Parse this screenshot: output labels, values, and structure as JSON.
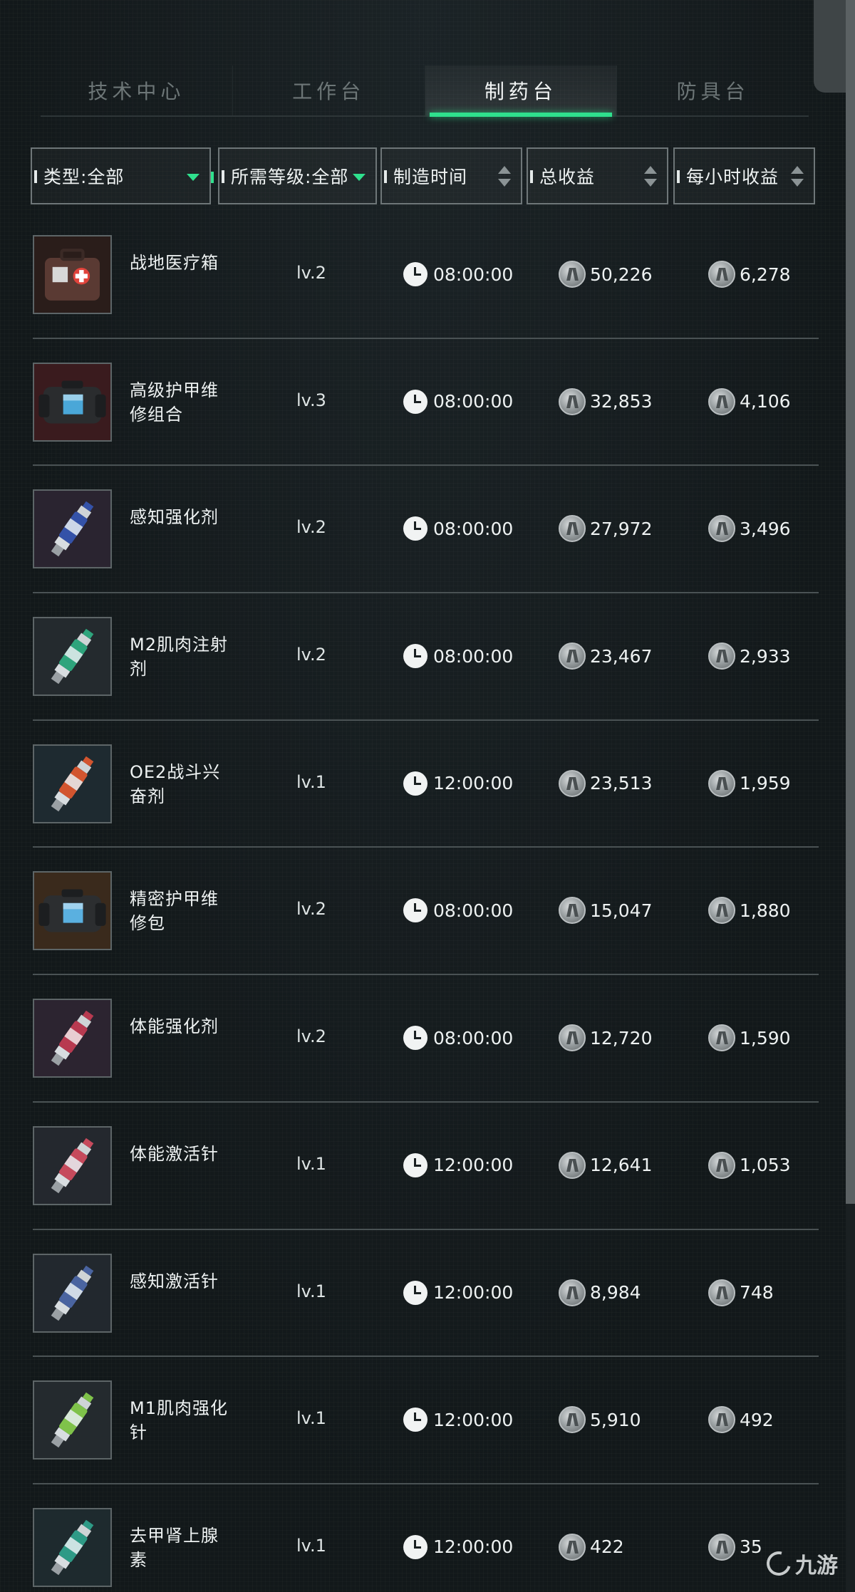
{
  "tabs": [
    {
      "label": "技术中心",
      "active": false
    },
    {
      "label": "工作台",
      "active": false
    },
    {
      "label": "制药台",
      "active": true
    },
    {
      "label": "防具台",
      "active": false
    }
  ],
  "filters": {
    "type": "类型:全部",
    "level": "所需等级:全部",
    "time": "制造时间",
    "total": "总收益",
    "hourly": "每小时收益"
  },
  "items": [
    {
      "name": "战地医疗箱",
      "level": "lv.2",
      "time": "08:00:00",
      "total": "50,226",
      "hourly": "6,278",
      "icon": "medkit-icon"
    },
    {
      "name": "高级护甲维修组合",
      "level": "lv.3",
      "time": "08:00:00",
      "total": "32,853",
      "hourly": "4,106",
      "icon": "armor-repair-kit-icon"
    },
    {
      "name": "感知强化剂",
      "level": "lv.2",
      "time": "08:00:00",
      "total": "27,972",
      "hourly": "3,496",
      "icon": "injector-blue-icon"
    },
    {
      "name": "M2肌肉注射剂",
      "level": "lv.2",
      "time": "08:00:00",
      "total": "23,467",
      "hourly": "2,933",
      "icon": "injector-green-icon"
    },
    {
      "name": "OE2战斗兴奋剂",
      "level": "lv.1",
      "time": "12:00:00",
      "total": "23,513",
      "hourly": "1,959",
      "icon": "injector-orange-icon"
    },
    {
      "name": "精密护甲维修包",
      "level": "lv.2",
      "time": "08:00:00",
      "total": "15,047",
      "hourly": "1,880",
      "icon": "armor-repair-bag-icon"
    },
    {
      "name": "体能强化剂",
      "level": "lv.2",
      "time": "08:00:00",
      "total": "12,720",
      "hourly": "1,590",
      "icon": "injector-red-icon"
    },
    {
      "name": "体能激活针",
      "level": "lv.1",
      "time": "12:00:00",
      "total": "12,641",
      "hourly": "1,053",
      "icon": "injector-pink-icon"
    },
    {
      "name": "感知激活针",
      "level": "lv.1",
      "time": "12:00:00",
      "total": "8,984",
      "hourly": "748",
      "icon": "injector-slate-icon"
    },
    {
      "name": "M1肌肉强化针",
      "level": "lv.1",
      "time": "12:00:00",
      "total": "5,910",
      "hourly": "492",
      "icon": "injector-lime-icon"
    },
    {
      "name": "去甲肾上腺素",
      "level": "lv.1",
      "time": "12:00:00",
      "total": "422",
      "hourly": "35",
      "icon": "injector-teal-icon"
    }
  ],
  "watermark": "九游",
  "colors": {
    "accent": "#2fe08d",
    "background": "#12181a",
    "divider": "#4a5254"
  }
}
